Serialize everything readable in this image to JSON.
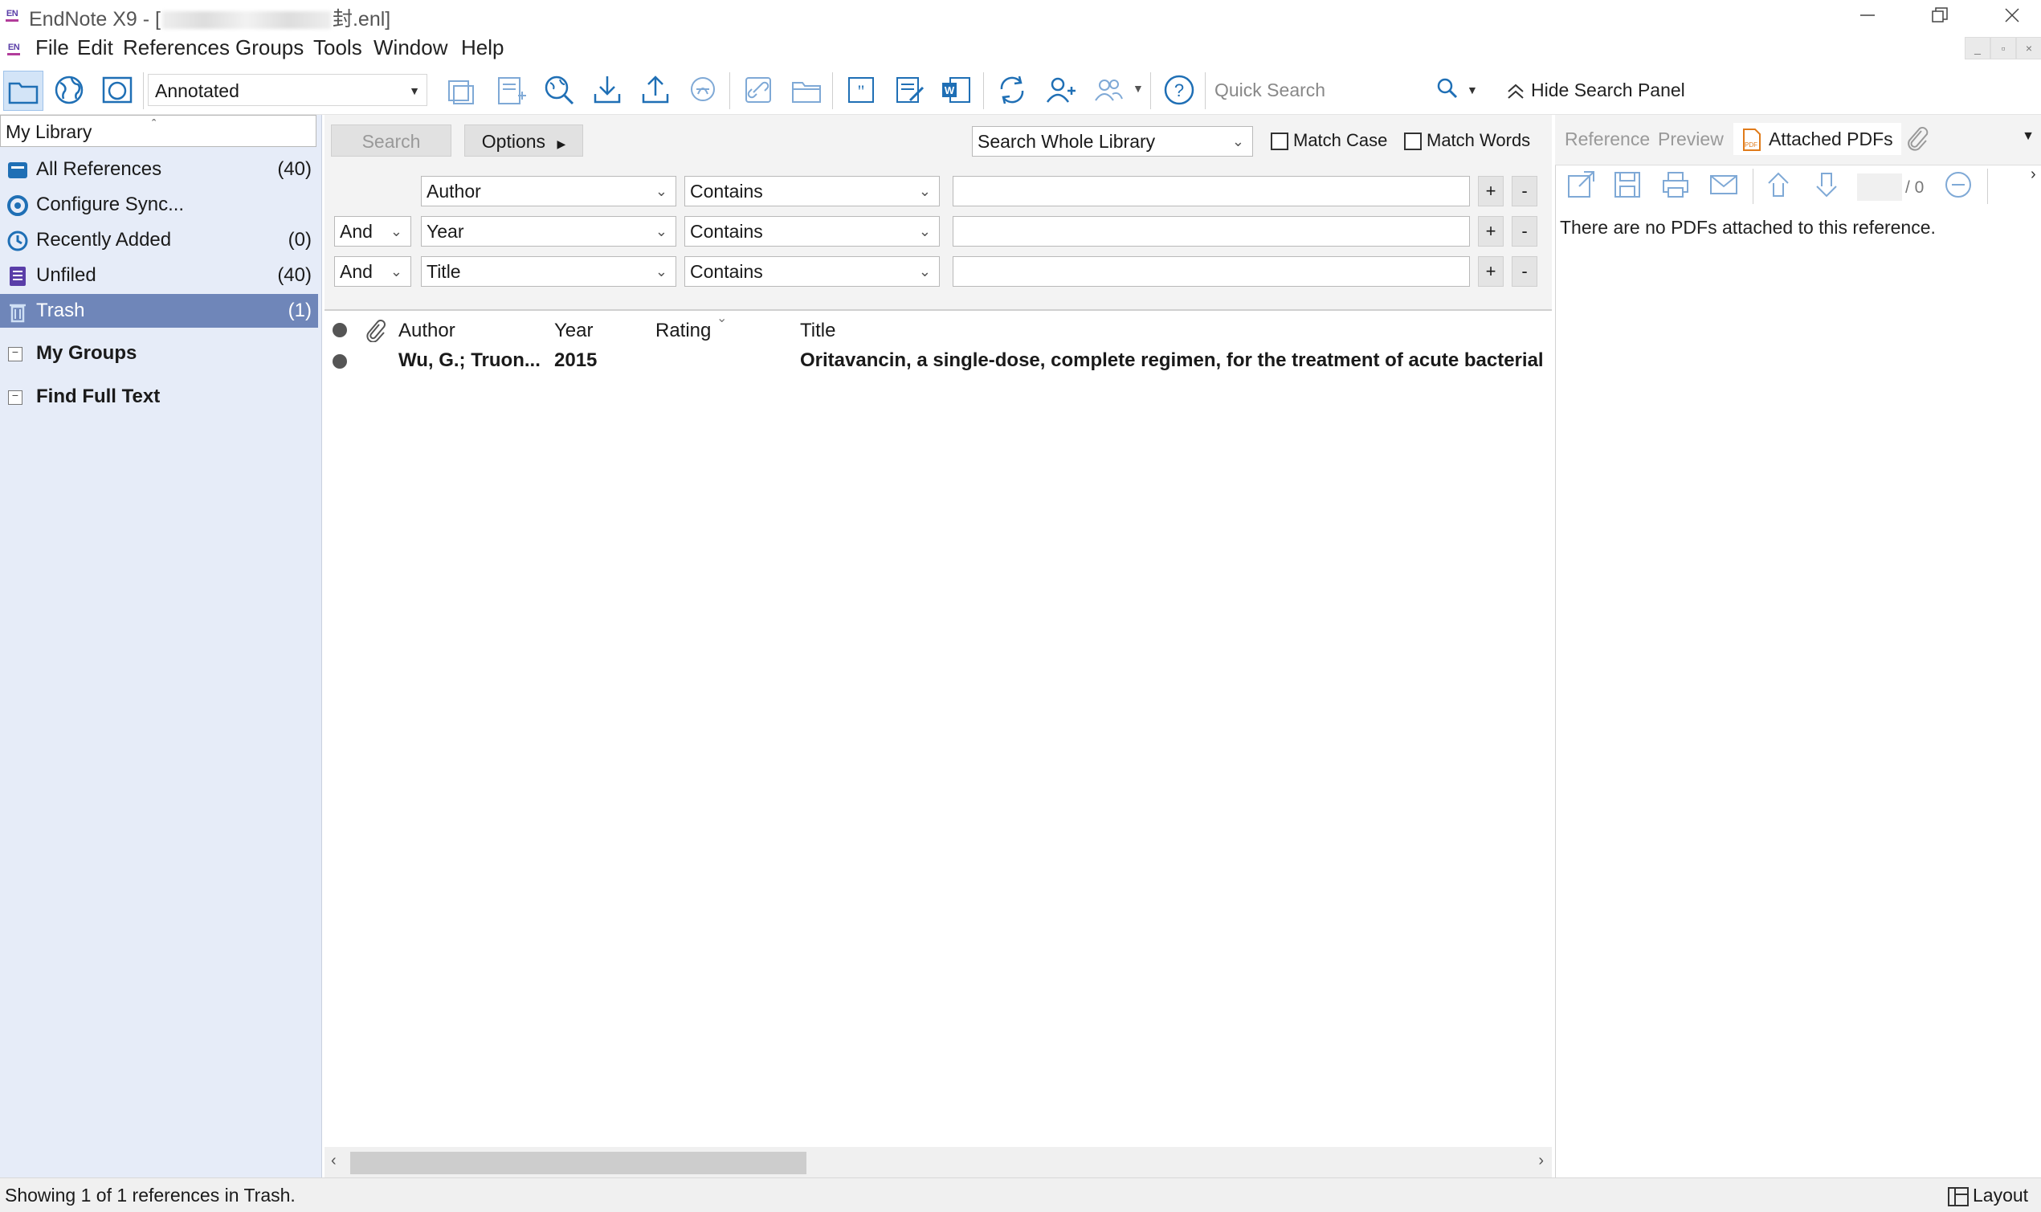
{
  "window": {
    "title_prefix": "EndNote X9 - [",
    "title_suffix": "封.enl]",
    "logo": "EN"
  },
  "menu": [
    "File",
    "Edit",
    "References",
    "Groups",
    "Tools",
    "Window",
    "Help"
  ],
  "toolbar": {
    "style_value": "Annotated",
    "quick_search_placeholder": "Quick Search",
    "hide_search_panel": "Hide Search Panel"
  },
  "library": {
    "header": "My Library",
    "groups": [
      {
        "label": "All References",
        "count": "(40)",
        "icon": "all-references-icon"
      },
      {
        "label": "Configure Sync...",
        "count": "",
        "icon": "sync-icon"
      },
      {
        "label": "Recently Added",
        "count": "(0)",
        "icon": "clock-icon"
      },
      {
        "label": "Unfiled",
        "count": "(40)",
        "icon": "unfiled-icon"
      },
      {
        "label": "Trash",
        "count": "(1)",
        "icon": "trash-icon"
      }
    ],
    "sections": [
      "My Groups",
      "Find Full Text"
    ]
  },
  "search": {
    "search_button": "Search",
    "options_button": "Options",
    "scope": "Search Whole Library",
    "match_case": "Match Case",
    "match_words": "Match Words",
    "rows": [
      {
        "bool": "",
        "field": "Author",
        "op": "Contains"
      },
      {
        "bool": "And",
        "field": "Year",
        "op": "Contains"
      },
      {
        "bool": "And",
        "field": "Title",
        "op": "Contains"
      }
    ],
    "plus": "+",
    "minus": "-"
  },
  "ref_list": {
    "columns": {
      "author": "Author",
      "year": "Year",
      "rating": "Rating",
      "title": "Title"
    },
    "rows": [
      {
        "author": "Wu, G.; Truon...",
        "year": "2015",
        "rating": "",
        "title": "Oritavancin, a single-dose, complete regimen, for the treatment of acute bacterial"
      }
    ]
  },
  "right_panel": {
    "tabs": [
      "Reference",
      "Preview",
      "Attached PDFs"
    ],
    "page_total": "/ 0",
    "message": "There are no PDFs attached to this reference."
  },
  "status": {
    "text": "Showing 1 of 1 references in Trash.",
    "layout": "Layout"
  },
  "colors": {
    "selection": "#6f86b9",
    "left_panel_bg": "#e6ecf8",
    "icon_blue": "#1f6fb5",
    "logo_purple": "#5a3ea8"
  }
}
